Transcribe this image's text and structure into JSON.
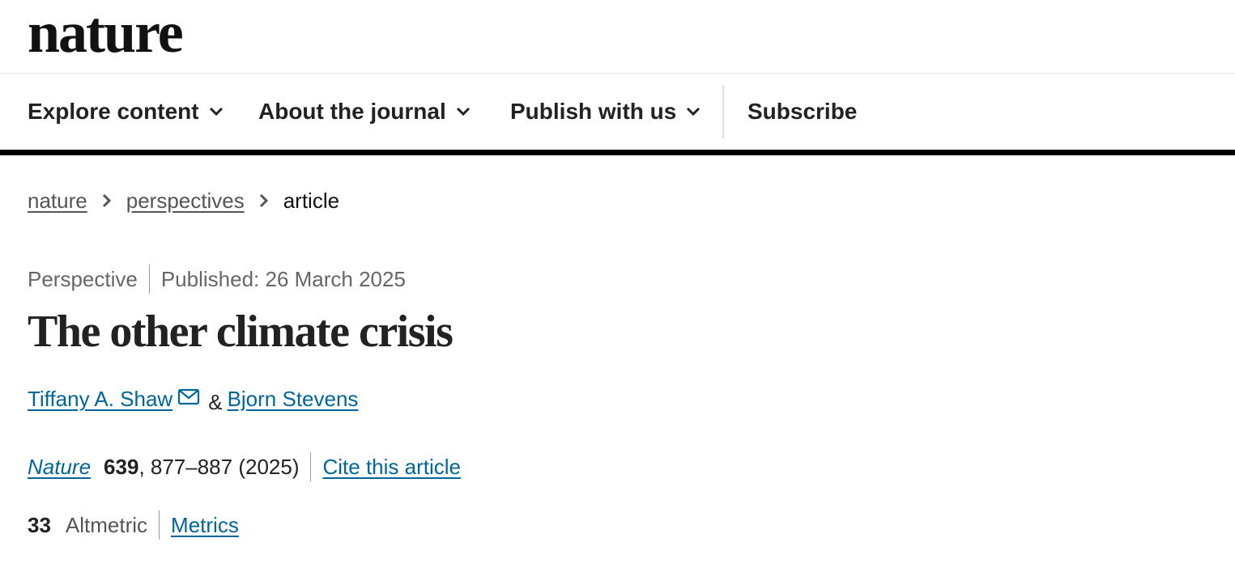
{
  "header": {
    "logo": "nature"
  },
  "nav": {
    "items": [
      {
        "label": "Explore content",
        "has_dropdown": true
      },
      {
        "label": "About the journal",
        "has_dropdown": true
      },
      {
        "label": "Publish with us",
        "has_dropdown": true
      },
      {
        "label": "Subscribe",
        "has_dropdown": false
      }
    ]
  },
  "breadcrumb": {
    "items": [
      "nature",
      "perspectives"
    ],
    "current": "article"
  },
  "article": {
    "type": "Perspective",
    "published": "Published: 26 March 2025",
    "title": "The other climate crisis",
    "authors": [
      "Tiffany A. Shaw",
      "Bjorn Stevens"
    ],
    "author_separator": "&",
    "citation": {
      "journal": "Nature",
      "volume": "639",
      "pages_year": ", 877–887 (2025)",
      "cite_label": "Cite this article"
    },
    "metrics": {
      "altmetric_count": "33",
      "altmetric_label": "Altmetric",
      "metrics_link": "Metrics"
    }
  },
  "colors": {
    "link": "#006699",
    "text": "#222222",
    "muted": "#666666",
    "nav_border": "#000000"
  }
}
